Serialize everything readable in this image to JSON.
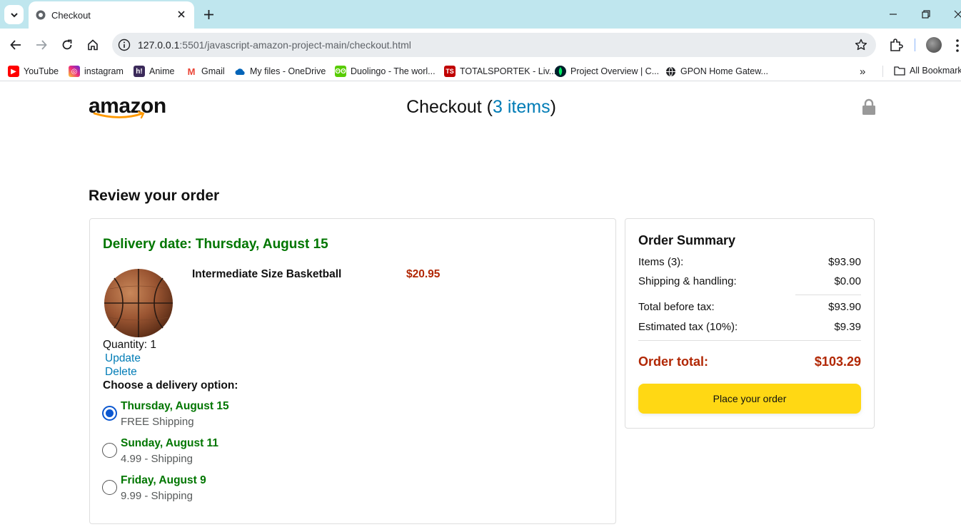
{
  "browser": {
    "tab_title": "Checkout",
    "url_host": "127.0.0.1",
    "url_rest": ":5501/javascript-amazon-project-main/checkout.html",
    "bookmarks": [
      {
        "label": "YouTube",
        "icon": "youtube-icon",
        "color": "#ff0000"
      },
      {
        "label": "instagram",
        "icon": "instagram-icon",
        "color": "#d6249f"
      },
      {
        "label": "Anime",
        "icon": "hianime-icon",
        "color": "#5a3a8a"
      },
      {
        "label": "Gmail",
        "icon": "gmail-icon",
        "color": "#ea4335"
      },
      {
        "label": "My files - OneDrive",
        "icon": "onedrive-icon",
        "color": "#0364b8"
      },
      {
        "label": "Duolingo - The worl...",
        "icon": "duolingo-icon",
        "color": "#58cc02"
      },
      {
        "label": "TOTALSPORTEK - Liv...",
        "icon": "totalsportek-icon",
        "color": "#c00000"
      },
      {
        "label": "Project Overview | C...",
        "icon": "mongodb-icon",
        "color": "#00684a"
      },
      {
        "label": "GPON Home Gatew...",
        "icon": "globe-icon",
        "color": "#202124"
      }
    ],
    "all_bookmarks_label": "All Bookmarks"
  },
  "header": {
    "logo_text": "amazon",
    "checkout_prefix": "Checkout (",
    "items_link": "3 items",
    "checkout_suffix": ")"
  },
  "page": {
    "review_title": "Review your order"
  },
  "cart_item": {
    "delivery_date": "Delivery date: Thursday, August 15",
    "product_name": "Intermediate Size Basketball",
    "product_price": "$20.95",
    "quantity": "Quantity: 1",
    "update_label": "Update",
    "delete_label": "Delete",
    "choose_label": "Choose a delivery option:",
    "options": [
      {
        "date": "Thursday, August 15",
        "price": "FREE Shipping",
        "selected": true
      },
      {
        "date": "Sunday, August 11",
        "price": "4.99 - Shipping",
        "selected": false
      },
      {
        "date": "Friday, August 9",
        "price": "9.99 - Shipping",
        "selected": false
      }
    ]
  },
  "summary": {
    "title": "Order Summary",
    "rows": [
      {
        "label": "Items (3):",
        "value": "$93.90"
      },
      {
        "label": "Shipping & handling:",
        "value": "$0.00"
      },
      {
        "label": "Total before tax:",
        "value": "$93.90"
      },
      {
        "label": "Estimated tax (10%):",
        "value": "$9.39"
      }
    ],
    "total_label": "Order total:",
    "total_value": "$103.29",
    "place_order_label": "Place your order"
  },
  "colors": {
    "accent_green": "#007600",
    "price_red": "#b12704",
    "link_blue": "#017cb6",
    "button_yellow": "#ffd814"
  }
}
